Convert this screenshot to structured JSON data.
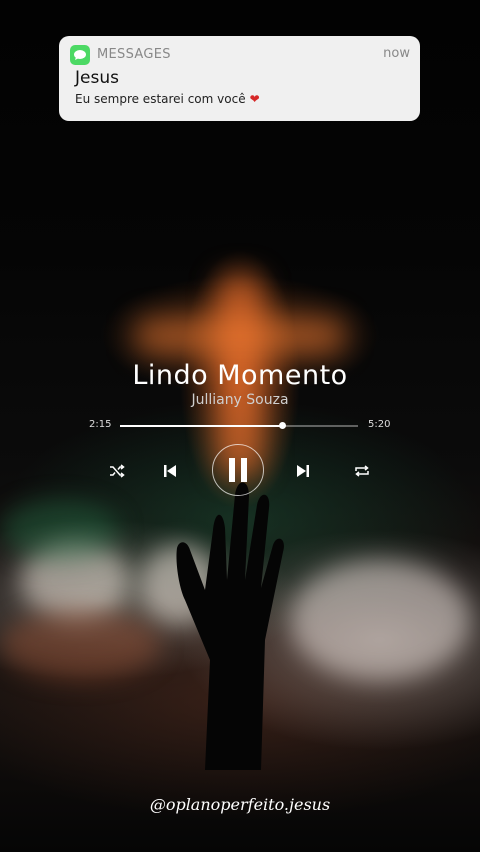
{
  "notification": {
    "app_name": "MESSAGES",
    "time": "now",
    "sender": "Jesus",
    "message": "Eu sempre estarei com você",
    "icon": "messages-icon",
    "heart_icon": "red-heart-icon",
    "accent_color": "#4cd964"
  },
  "player": {
    "title": "Lindo Momento",
    "artist": "Julliany Souza",
    "elapsed": "2:15",
    "duration": "5:20",
    "progress": 0.68,
    "controls": [
      "shuffle-icon",
      "previous-icon",
      "pause-icon",
      "next-icon",
      "repeat-icon"
    ]
  },
  "footer": {
    "handle": "@oplanoperfeito.jesus"
  }
}
